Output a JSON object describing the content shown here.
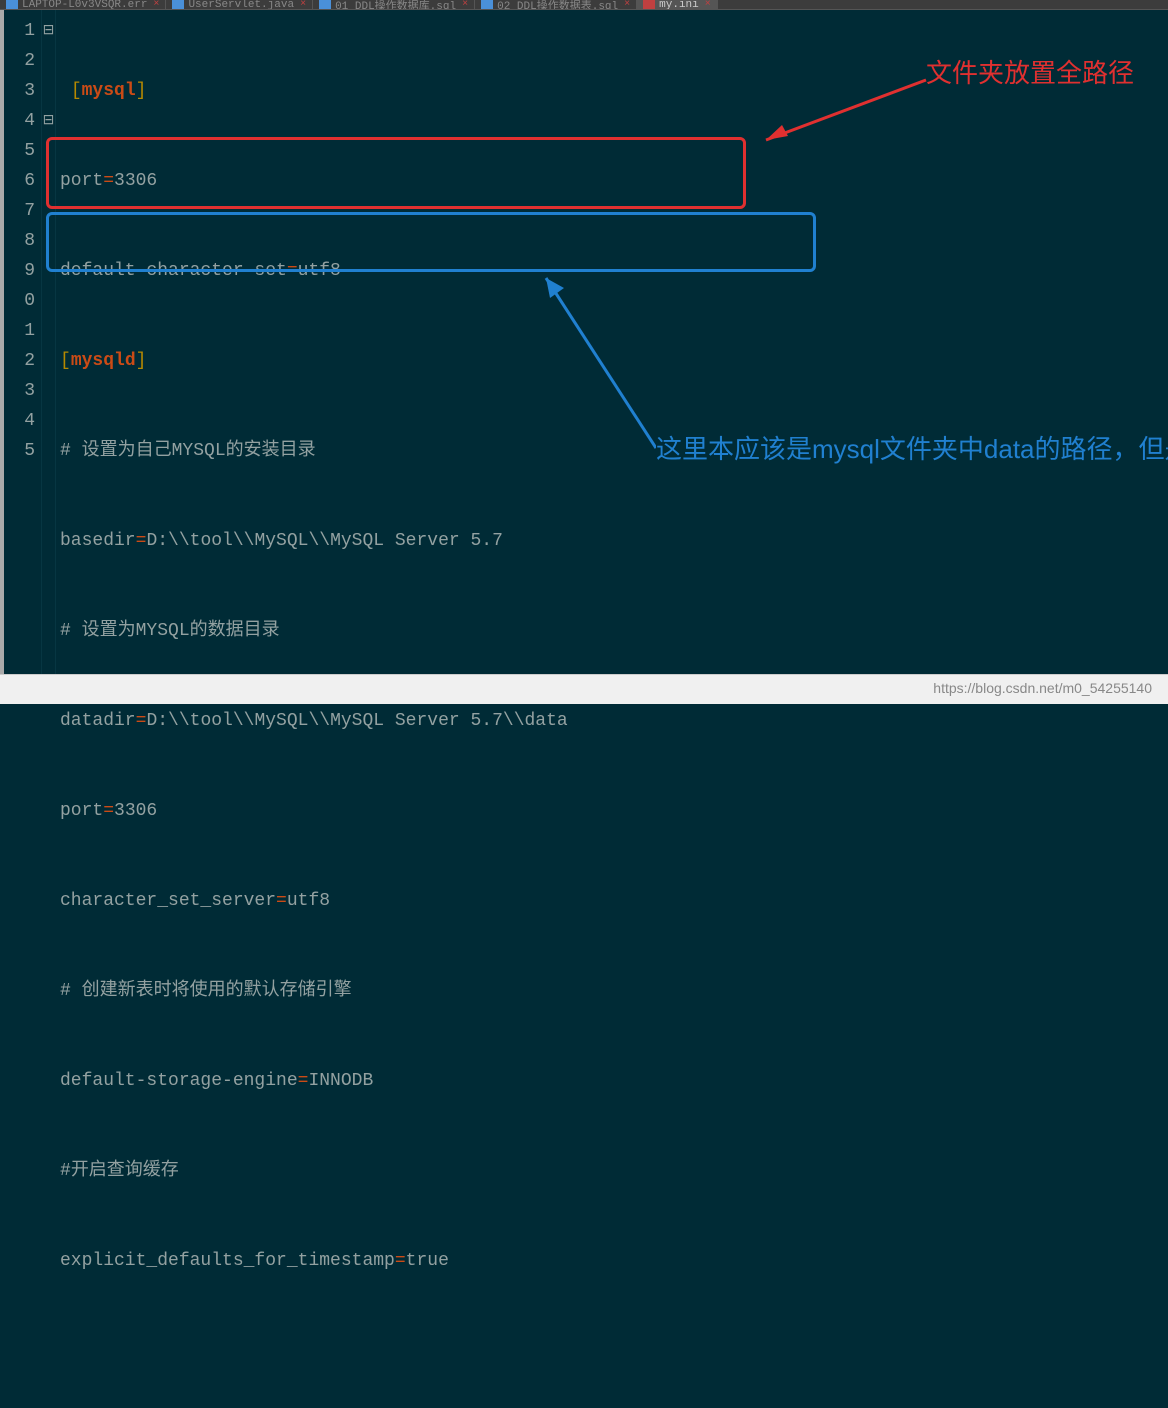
{
  "tabs": [
    {
      "icon": "blue",
      "label": "LAPTOP-L0v3VSQR.err"
    },
    {
      "icon": "blue",
      "label": "UserServlet.java"
    },
    {
      "icon": "blue",
      "label": "01_DDL操作数据库.sql"
    },
    {
      "icon": "blue",
      "label": "02_DDL操作数据表.sql"
    },
    {
      "icon": "red",
      "label": "my.ini",
      "active": true
    }
  ],
  "gutter": [
    "1",
    "2",
    "3",
    "4",
    "5",
    "6",
    "7",
    "8",
    "9",
    "0",
    "1",
    "2",
    "3",
    "4",
    "5"
  ],
  "fold_marks": {
    "0": "⊟",
    "3": "⊟"
  },
  "code": {
    "l1": {
      "open_br": "[",
      "section": "mysql",
      "close_br": "]"
    },
    "l2": {
      "key": "port",
      "eq": "=",
      "val": "3306"
    },
    "l3": {
      "key": "default-character-set",
      "eq": "=",
      "val": "utf8"
    },
    "l4": {
      "open_br": "[",
      "section": "mysqld",
      "close_br": "]"
    },
    "l5": {
      "hash": "# ",
      "comment": "设置为自己MYSQL的安装目录"
    },
    "l6": {
      "key": "basedir",
      "eq": "=",
      "val": "D:\\\\tool\\\\MySQL\\\\MySQL Server 5.7"
    },
    "l7": {
      "hash": "# ",
      "comment": "设置为MYSQL的数据目录"
    },
    "l8": {
      "key": "datadir",
      "eq": "=",
      "val": "D:\\\\tool\\\\MySQL\\\\MySQL Server 5.7\\\\data"
    },
    "l9": {
      "key": "port",
      "eq": "=",
      "val": "3306"
    },
    "l10": {
      "key": "character_set_server",
      "eq": "=",
      "val": "utf8"
    },
    "l11": {
      "hash": "# ",
      "comment": "创建新表时将使用的默认存储引擎"
    },
    "l12": {
      "key": "default-storage-engine",
      "eq": "=",
      "val": "INNODB"
    },
    "l13": {
      "hash": "#",
      "comment": "开启查询缓存"
    },
    "l14": {
      "key": "explicit_defaults_for_timestamp",
      "eq": "=",
      "val": "true"
    }
  },
  "annotations": {
    "red_text": "文件夹放置全路径",
    "blue_text": "这里本应该是mysql文件夹中data的路径，但是由于没有在控制台操作。所以目前没有data目录，上面的路径复制下来，加上\\\\data。"
  },
  "watermark": "https://blog.csdn.net/m0_54255140"
}
